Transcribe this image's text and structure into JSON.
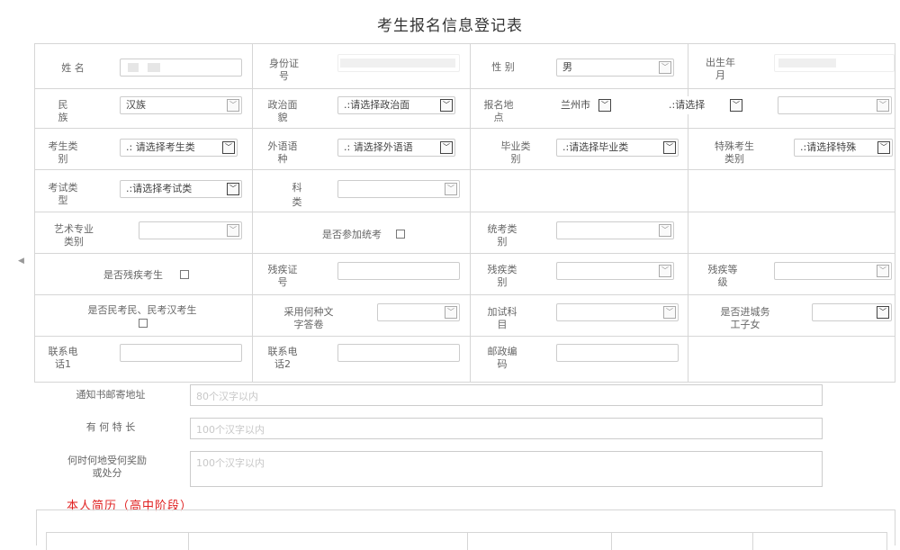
{
  "form": {
    "title": "考生报名信息登记表",
    "labels": {
      "name": "姓 名",
      "id_card_1": "身份证",
      "id_card_2": "号",
      "gender": "性 别",
      "birth_1": "出生年",
      "birth_2": "月",
      "ethnicity_1": "民",
      "ethnicity_2": "族",
      "politics_1": "政治面",
      "politics_2": "貌",
      "reg_place_1": "报名地",
      "reg_place_2": "点",
      "exam_type_1": "考生类",
      "exam_type_2": "别",
      "foreign_lang_1": "外语语",
      "foreign_lang_2": "种",
      "grad_type_1": "毕业类",
      "grad_type_2": "别",
      "special_1": "特殊考生",
      "special_2": "类别",
      "test_type_1": "考试类",
      "test_type_2": "型",
      "subject_1": "科",
      "subject_2": "类",
      "art_1": "艺术专业",
      "art_2": "类别",
      "unified_exam": "是否参加统考",
      "unified_type_1": "统考类",
      "unified_type_2": "别",
      "disabled": "是否残疾考生",
      "disab_cert_1": "残疾证",
      "disab_cert_2": "号",
      "disab_type_1": "残疾类",
      "disab_type_2": "别",
      "disab_level_1": "残疾等",
      "disab_level_2": "级",
      "minority": "是否民考民、民考汉考生",
      "script_1": "采用何种文",
      "script_2": "字答卷",
      "extra_subj_1": "加试科",
      "extra_subj_2": "目",
      "migrant_1": "是否进城务",
      "migrant_2": "工子女",
      "phone1_1": "联系电",
      "phone1_2": "话1",
      "phone2_1": "联系电",
      "phone2_2": "话2",
      "postcode_1": "邮政编",
      "postcode_2": "码",
      "mail_addr": "通知书邮寄地址",
      "specialty": "有 何 特 长",
      "awards_1": "何时何地受何奖励",
      "awards_2": "或处分"
    },
    "values": {
      "gender": "男",
      "ethnicity": "汉族",
      "politics": ".:请选择政治面",
      "reg_city": "兰州市",
      "reg_district": ".:请选择",
      "exam_type": ".: 请选择考生类",
      "foreign_lang": ".: 请选择外语语",
      "grad_type": ".:请选择毕业类",
      "special": ".:请选择特殊",
      "test_type": ".:请选择考试类",
      "dropdown_arrow": "﹀"
    },
    "placeholders": {
      "mail_addr": "80个汉字以内",
      "specialty": "100个汉字以内",
      "awards": "100个汉字以内"
    },
    "section": {
      "resume_title": "本人简历（高中阶段）"
    }
  }
}
